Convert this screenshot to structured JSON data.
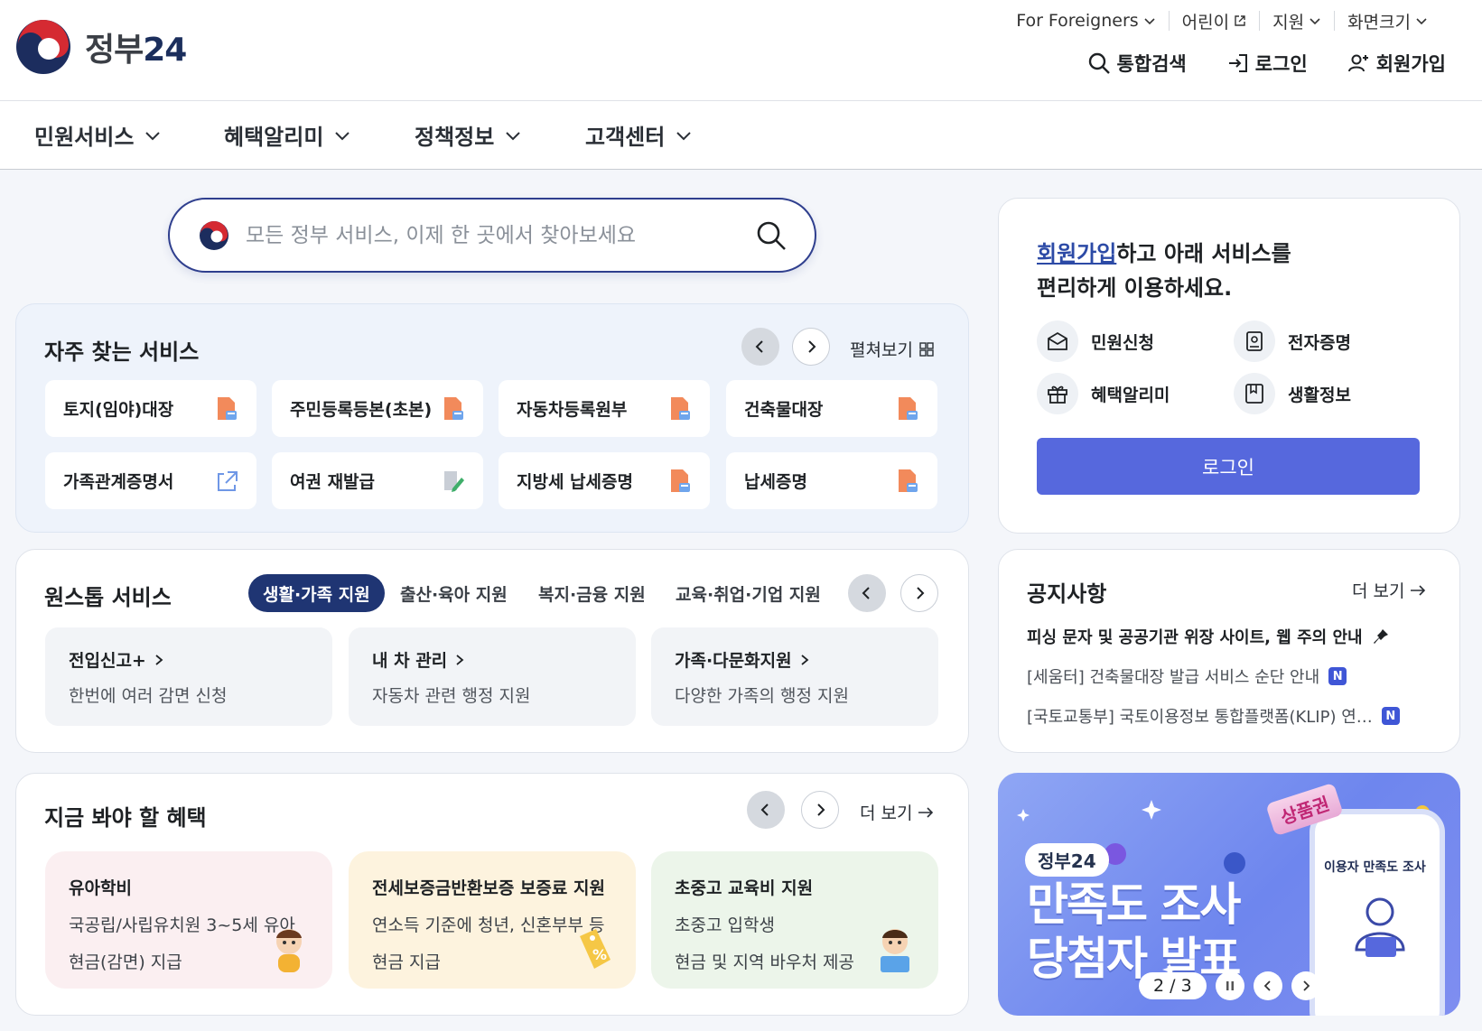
{
  "header": {
    "logo_text": "정부",
    "logo_num": "24",
    "util": [
      {
        "label": "For Foreigners",
        "icon": "chevron-down-icon"
      },
      {
        "label": "어린이",
        "icon": "external-link-icon"
      },
      {
        "label": "지원",
        "icon": "chevron-down-icon"
      },
      {
        "label": "화면크기",
        "icon": "chevron-down-icon"
      }
    ],
    "actions": {
      "search": "통합검색",
      "login": "로그인",
      "signup": "회원가입"
    }
  },
  "gnb": [
    "민원서비스",
    "혜택알리미",
    "정책정보",
    "고객센터"
  ],
  "search": {
    "placeholder": "모든 정부 서비스, 이제 한 곳에서 찾아보세요"
  },
  "frequent": {
    "title": "자주 찾는 서비스",
    "expand_label": "펼쳐보기",
    "items": [
      {
        "label": "토지(임야)대장",
        "icon": "pdf-file-icon"
      },
      {
        "label": "주민등록등본(초본)",
        "icon": "pdf-file-icon"
      },
      {
        "label": "자동차등록원부",
        "icon": "pdf-file-icon"
      },
      {
        "label": "건축물대장",
        "icon": "pdf-file-icon"
      },
      {
        "label": "가족관계증명서",
        "icon": "external-link-icon"
      },
      {
        "label": "여권 재발급",
        "icon": "edit-document-icon"
      },
      {
        "label": "지방세 납세증명",
        "icon": "pdf-file-icon"
      },
      {
        "label": "납세증명",
        "icon": "pdf-file-icon"
      }
    ]
  },
  "onestop": {
    "title": "원스톱 서비스",
    "tabs": [
      "생활·가족 지원",
      "출산·육아 지원",
      "복지·금융 지원",
      "교육·취업·기업 지원"
    ],
    "items": [
      {
        "title": "전입신고+",
        "desc": "한번에 여러 감면 신청"
      },
      {
        "title": "내 차 관리",
        "desc": "자동차 관련 행정 지원"
      },
      {
        "title": "가족·다문화지원",
        "desc": "다양한 가족의 행정 지원"
      }
    ]
  },
  "benefits": {
    "title": "지금 봐야 할 혜택",
    "more": "더 보기",
    "items": [
      {
        "title": "유아학비",
        "line1": "국공립/사립유치원 3~5세 유아",
        "line2": "현금(감면) 지급",
        "bg": "#fbeff1"
      },
      {
        "title": "전세보증금반환보증 보증료 지원",
        "line1": "연소득 기준에 청년, 신혼부부 등",
        "line2": "현금 지급",
        "bg": "#fdf3de"
      },
      {
        "title": "초중고 교육비 지원",
        "line1": "초중고 입학생",
        "line2": "현금 및 지역 바우처 제공",
        "bg": "#ecf5ea"
      }
    ]
  },
  "login_card": {
    "msg_highlight": "회원가입",
    "msg_rest1": "하고 아래 서비스를",
    "msg_line2": "편리하게 이용하세요.",
    "services": [
      "민원신청",
      "전자증명",
      "혜택알리미",
      "생활정보"
    ],
    "login_button": "로그인"
  },
  "notice": {
    "title": "공지사항",
    "more": "더 보기",
    "items": [
      {
        "text": "피싱 문자 및 공공기관 위장 사이트, 웹 주의 안내",
        "badge": ""
      },
      {
        "text": "[세움터] 건축물대장 발급 서비스 순단 안내",
        "badge": "N"
      },
      {
        "text": "[국토교통부] 국토이용정보 통합플랫폼(KLIP) 연…",
        "badge": "N"
      }
    ]
  },
  "banner": {
    "logo": "정부24",
    "title_line1": "만족도 조사",
    "title_line2": "당첨자 발표",
    "ticket": "상품권",
    "phone_title": "이용자 만족도 조사",
    "pager": "2 / 3"
  },
  "colors": {
    "primary": "#1f3573",
    "login_button": "#5668dd",
    "badge": "#3f56d6"
  }
}
